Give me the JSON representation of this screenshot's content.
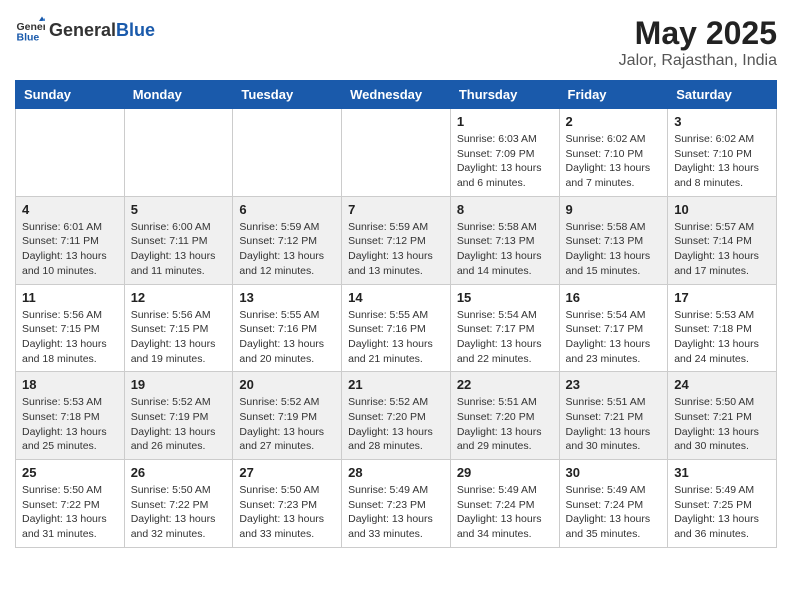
{
  "logo": {
    "general": "General",
    "blue": "Blue"
  },
  "title": "May 2025",
  "location": "Jalor, Rajasthan, India",
  "days_of_week": [
    "Sunday",
    "Monday",
    "Tuesday",
    "Wednesday",
    "Thursday",
    "Friday",
    "Saturday"
  ],
  "weeks": [
    [
      {
        "day": "",
        "info": ""
      },
      {
        "day": "",
        "info": ""
      },
      {
        "day": "",
        "info": ""
      },
      {
        "day": "",
        "info": ""
      },
      {
        "day": "1",
        "info": "Sunrise: 6:03 AM\nSunset: 7:09 PM\nDaylight: 13 hours\nand 6 minutes."
      },
      {
        "day": "2",
        "info": "Sunrise: 6:02 AM\nSunset: 7:10 PM\nDaylight: 13 hours\nand 7 minutes."
      },
      {
        "day": "3",
        "info": "Sunrise: 6:02 AM\nSunset: 7:10 PM\nDaylight: 13 hours\nand 8 minutes."
      }
    ],
    [
      {
        "day": "4",
        "info": "Sunrise: 6:01 AM\nSunset: 7:11 PM\nDaylight: 13 hours\nand 10 minutes."
      },
      {
        "day": "5",
        "info": "Sunrise: 6:00 AM\nSunset: 7:11 PM\nDaylight: 13 hours\nand 11 minutes."
      },
      {
        "day": "6",
        "info": "Sunrise: 5:59 AM\nSunset: 7:12 PM\nDaylight: 13 hours\nand 12 minutes."
      },
      {
        "day": "7",
        "info": "Sunrise: 5:59 AM\nSunset: 7:12 PM\nDaylight: 13 hours\nand 13 minutes."
      },
      {
        "day": "8",
        "info": "Sunrise: 5:58 AM\nSunset: 7:13 PM\nDaylight: 13 hours\nand 14 minutes."
      },
      {
        "day": "9",
        "info": "Sunrise: 5:58 AM\nSunset: 7:13 PM\nDaylight: 13 hours\nand 15 minutes."
      },
      {
        "day": "10",
        "info": "Sunrise: 5:57 AM\nSunset: 7:14 PM\nDaylight: 13 hours\nand 17 minutes."
      }
    ],
    [
      {
        "day": "11",
        "info": "Sunrise: 5:56 AM\nSunset: 7:15 PM\nDaylight: 13 hours\nand 18 minutes."
      },
      {
        "day": "12",
        "info": "Sunrise: 5:56 AM\nSunset: 7:15 PM\nDaylight: 13 hours\nand 19 minutes."
      },
      {
        "day": "13",
        "info": "Sunrise: 5:55 AM\nSunset: 7:16 PM\nDaylight: 13 hours\nand 20 minutes."
      },
      {
        "day": "14",
        "info": "Sunrise: 5:55 AM\nSunset: 7:16 PM\nDaylight: 13 hours\nand 21 minutes."
      },
      {
        "day": "15",
        "info": "Sunrise: 5:54 AM\nSunset: 7:17 PM\nDaylight: 13 hours\nand 22 minutes."
      },
      {
        "day": "16",
        "info": "Sunrise: 5:54 AM\nSunset: 7:17 PM\nDaylight: 13 hours\nand 23 minutes."
      },
      {
        "day": "17",
        "info": "Sunrise: 5:53 AM\nSunset: 7:18 PM\nDaylight: 13 hours\nand 24 minutes."
      }
    ],
    [
      {
        "day": "18",
        "info": "Sunrise: 5:53 AM\nSunset: 7:18 PM\nDaylight: 13 hours\nand 25 minutes."
      },
      {
        "day": "19",
        "info": "Sunrise: 5:52 AM\nSunset: 7:19 PM\nDaylight: 13 hours\nand 26 minutes."
      },
      {
        "day": "20",
        "info": "Sunrise: 5:52 AM\nSunset: 7:19 PM\nDaylight: 13 hours\nand 27 minutes."
      },
      {
        "day": "21",
        "info": "Sunrise: 5:52 AM\nSunset: 7:20 PM\nDaylight: 13 hours\nand 28 minutes."
      },
      {
        "day": "22",
        "info": "Sunrise: 5:51 AM\nSunset: 7:20 PM\nDaylight: 13 hours\nand 29 minutes."
      },
      {
        "day": "23",
        "info": "Sunrise: 5:51 AM\nSunset: 7:21 PM\nDaylight: 13 hours\nand 30 minutes."
      },
      {
        "day": "24",
        "info": "Sunrise: 5:50 AM\nSunset: 7:21 PM\nDaylight: 13 hours\nand 30 minutes."
      }
    ],
    [
      {
        "day": "25",
        "info": "Sunrise: 5:50 AM\nSunset: 7:22 PM\nDaylight: 13 hours\nand 31 minutes."
      },
      {
        "day": "26",
        "info": "Sunrise: 5:50 AM\nSunset: 7:22 PM\nDaylight: 13 hours\nand 32 minutes."
      },
      {
        "day": "27",
        "info": "Sunrise: 5:50 AM\nSunset: 7:23 PM\nDaylight: 13 hours\nand 33 minutes."
      },
      {
        "day": "28",
        "info": "Sunrise: 5:49 AM\nSunset: 7:23 PM\nDaylight: 13 hours\nand 33 minutes."
      },
      {
        "day": "29",
        "info": "Sunrise: 5:49 AM\nSunset: 7:24 PM\nDaylight: 13 hours\nand 34 minutes."
      },
      {
        "day": "30",
        "info": "Sunrise: 5:49 AM\nSunset: 7:24 PM\nDaylight: 13 hours\nand 35 minutes."
      },
      {
        "day": "31",
        "info": "Sunrise: 5:49 AM\nSunset: 7:25 PM\nDaylight: 13 hours\nand 36 minutes."
      }
    ]
  ]
}
